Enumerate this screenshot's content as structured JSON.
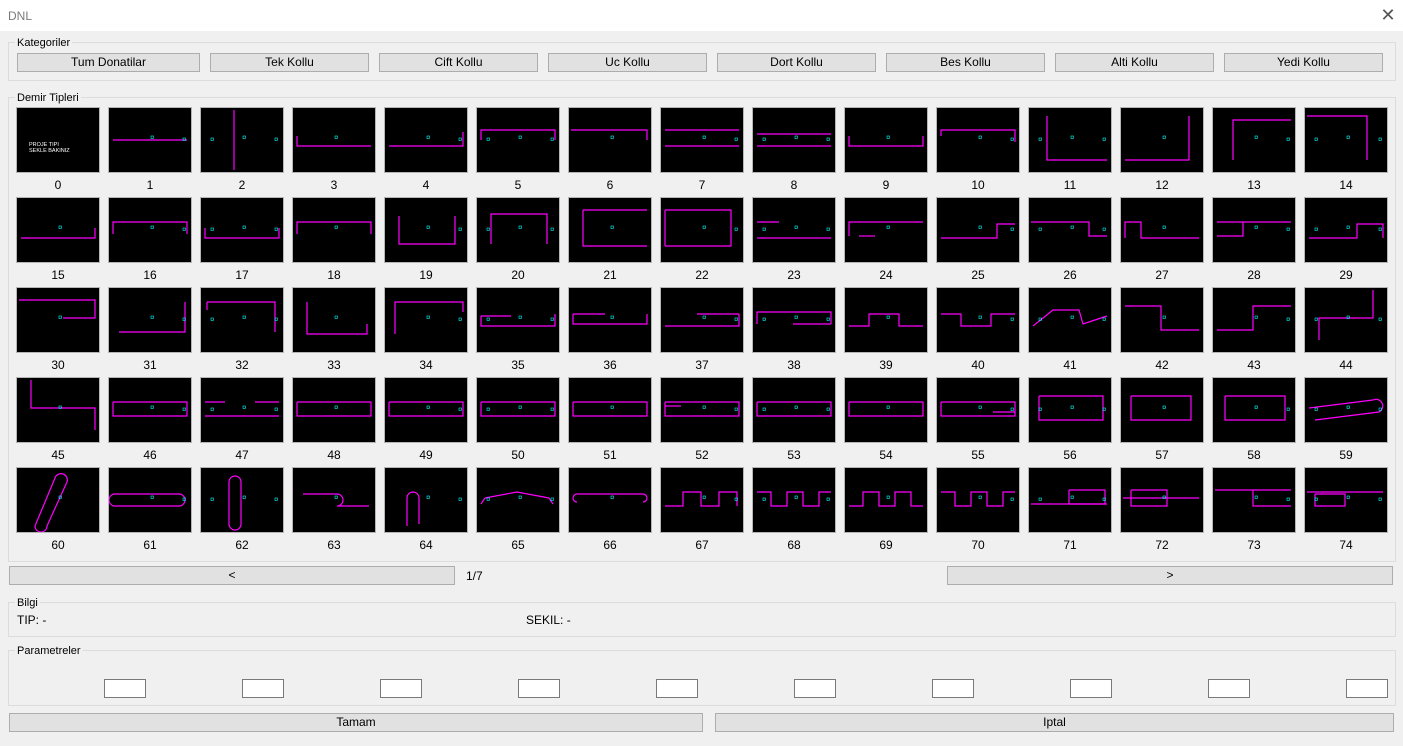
{
  "window": {
    "title": "DNL",
    "close_symbol": "✕"
  },
  "categories": {
    "legend": "Kategoriler",
    "buttons": [
      "Tum Donatilar",
      "Tek Kollu",
      "Cift Kollu",
      "Uc Kollu",
      "Dort Kollu",
      "Bes Kollu",
      "Alti Kollu",
      "Yedi Kollu"
    ]
  },
  "types": {
    "legend": "Demir Tipleri",
    "thumbnail_colors": {
      "background": "#000000",
      "shape": "#ff00ff",
      "dimension": "#00ffff"
    },
    "items": [
      "0",
      "1",
      "2",
      "3",
      "4",
      "5",
      "6",
      "7",
      "8",
      "9",
      "10",
      "11",
      "12",
      "13",
      "14",
      "15",
      "16",
      "17",
      "18",
      "19",
      "20",
      "21",
      "22",
      "23",
      "24",
      "25",
      "26",
      "27",
      "28",
      "29",
      "30",
      "31",
      "32",
      "33",
      "34",
      "35",
      "36",
      "37",
      "38",
      "39",
      "40",
      "41",
      "42",
      "43",
      "44",
      "45",
      "46",
      "47",
      "48",
      "49",
      "50",
      "51",
      "52",
      "53",
      "54",
      "55",
      "56",
      "57",
      "58",
      "59",
      "60",
      "61",
      "62",
      "63",
      "64",
      "65",
      "66",
      "67",
      "68",
      "69",
      "70",
      "71",
      "72",
      "73",
      "74"
    ],
    "thumb0_text": [
      "PROJE TIPI",
      "SEKLE BAKINIZ"
    ]
  },
  "pager": {
    "prev": "<",
    "next": ">",
    "page": "1/7"
  },
  "info": {
    "legend": "Bilgi",
    "tip": "TIP: -",
    "sekil": "SEKIL: -"
  },
  "params": {
    "legend": "Parametreler",
    "values": [
      "",
      "",
      "",
      "",
      "",
      "",
      "",
      "",
      "",
      ""
    ]
  },
  "footer": {
    "ok": "Tamam",
    "cancel": "Iptal"
  }
}
